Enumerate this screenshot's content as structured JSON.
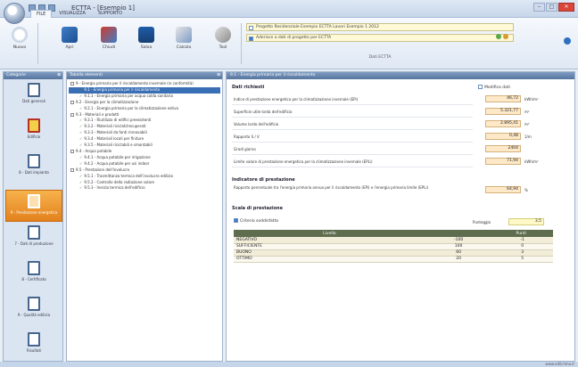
{
  "window": {
    "title": "ECTTA - [Esempio 1]",
    "controls": [
      "–",
      "□",
      "×"
    ]
  },
  "ribbon": {
    "tabs": [
      "FILE",
      "VISUALIZZA",
      "SUPPORTO"
    ],
    "buttons": [
      {
        "name": "new",
        "label": "Nuovo"
      },
      {
        "name": "open",
        "label": "Apri"
      },
      {
        "name": "close",
        "label": "Chiudi"
      },
      {
        "name": "save",
        "label": "Salva"
      },
      {
        "name": "calc",
        "label": "Calcola"
      },
      {
        "name": "tools",
        "label": "Tool"
      }
    ],
    "project_field": "Progetto Residenziale Esempio ECTTA Lavori Esempio 1 2012",
    "project_check": "Aderisce a dati di progetto per ECTTA",
    "project_group_label": "Dati ECTTA"
  },
  "nav": {
    "header": "Categorie",
    "items": [
      {
        "label": "Dati generali",
        "selected": false
      },
      {
        "label": "Edificio",
        "selected": false
      },
      {
        "label": "8 - Dati impianto",
        "selected": false
      },
      {
        "label": "9 - Prestazione energetica",
        "selected": true
      },
      {
        "label": "7 - Dati di produzione",
        "selected": false
      },
      {
        "label": "8 - Certificato",
        "selected": false
      },
      {
        "label": "9 - Qualità edilizia",
        "selected": false
      },
      {
        "label": "Risultati",
        "selected": false
      }
    ]
  },
  "tree": {
    "header": "Tabella elementi",
    "nodes": [
      {
        "text": "9 - Energia primaria per il riscaldamento invernale (in conformità)",
        "level": 0,
        "type": "exp"
      },
      {
        "text": "9.1 - Energia primaria per il riscaldamento",
        "level": 1,
        "type": "chk",
        "selected": true
      },
      {
        "text": "9.1.1 - Energia primaria per acqua calda sanitaria",
        "level": 1,
        "type": "chk"
      },
      {
        "text": "9.2 - Energia per la climatizzazione",
        "level": 0,
        "type": "exp"
      },
      {
        "text": "9.2.1 - Energia primaria per la climatizzazione estiva",
        "level": 1,
        "type": "chk"
      },
      {
        "text": "9.3 - Materiali e prodotti",
        "level": 0,
        "type": "exp"
      },
      {
        "text": "9.3.1 - Riutilizzo di edifici preesistenti",
        "level": 1,
        "type": "chk"
      },
      {
        "text": "9.3.2 - Materiali riciclati/recuperati",
        "level": 1,
        "type": "chk"
      },
      {
        "text": "9.3.3 - Materiali da fonti rinnovabili",
        "level": 1,
        "type": "chk"
      },
      {
        "text": "9.3.4 - Materiali locali per finiture",
        "level": 1,
        "type": "chk"
      },
      {
        "text": "9.3.5 - Materiali riciclabili e smontabili",
        "level": 1,
        "type": "chk"
      },
      {
        "text": "9.4 - Acqua potabile",
        "level": 0,
        "type": "exp"
      },
      {
        "text": "9.4.1 - Acqua potabile per irrigazione",
        "level": 1,
        "type": "chk"
      },
      {
        "text": "9.4.2 - Acqua potabile per usi indoor",
        "level": 1,
        "type": "chk"
      },
      {
        "text": "9.5 - Prestazioni dell'involucro",
        "level": 0,
        "type": "exp"
      },
      {
        "text": "9.5.1 - Trasmittanza termica dell'involucro edilizio",
        "level": 1,
        "type": "chk"
      },
      {
        "text": "9.5.2 - Controllo della radiazione solare",
        "level": 1,
        "type": "chk"
      },
      {
        "text": "9.5.3 - Inerzia termica dell'edificio",
        "level": 1,
        "type": "chk"
      }
    ]
  },
  "main": {
    "header": "9.1 - Energia primaria per il riscaldamento",
    "section1_title": "Dati richiesti",
    "modify_label": "Modifica dati",
    "rows": [
      {
        "label": "Indice di prestazione energetica per la climatizzazione invernale (EPi)",
        "value": "46,72",
        "unit": "kWh/m²"
      },
      {
        "label": "Superficie utile lorda dell'edificio",
        "value": "5.321,77",
        "unit": "m²"
      },
      {
        "label": "Volume lordo dell'edificio",
        "value": "2.895,41",
        "unit": "m³"
      },
      {
        "label": "Rapporto S / V",
        "value": "0,48",
        "unit": "1/m"
      },
      {
        "label": "Gradi giorno",
        "value": "2404",
        "unit": ""
      },
      {
        "label": "Limite valore di prestazione energetica per la climatizzazione invernale (EPLi)",
        "value": "71,94",
        "unit": "kWh/m²"
      }
    ],
    "section2_title": "Indicatore di prestazione",
    "indicator_label": "Rapporto percentuale tra l'energia primaria annua per il riscaldamento (EPi) e l'energia primaria limite (EPLi)",
    "indicator_value": "64,94",
    "indicator_unit": "%",
    "section3_title": "Scala di prestazione",
    "scale_check_label": "Criterio soddisfatto",
    "score_label": "Punteggio",
    "score_value": "3,5",
    "table_headers": [
      "Livello",
      "Punti"
    ],
    "table_rows": [
      {
        "level": "NEGATIVO",
        "value": "-100",
        "points": "-1"
      },
      {
        "level": "SUFFICIENTE",
        "value": "100",
        "points": "0"
      },
      {
        "level": "BUONO",
        "value": "60",
        "points": "3"
      },
      {
        "level": "OTTIMO",
        "value": "20",
        "points": "5"
      }
    ]
  },
  "watermark": "www.edilclima.it"
}
